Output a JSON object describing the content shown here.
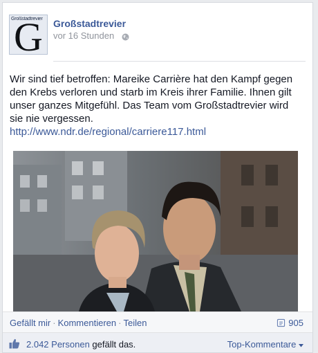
{
  "post": {
    "page_name": "Großstadtrevier",
    "logo_text": "Großstadtrevier",
    "logo_letter": "G",
    "time": "vor 16 Stunden",
    "visibility_icon": "globe-icon",
    "text": "Wir sind tief betroffen: Mareike Carrière hat den Kampf gegen den Krebs verloren und starb im Kreis ihrer Familie. Ihnen gilt unser ganzes Mitgefühl. Das Team vom Großstadtrevier wird sie nie vergessen.",
    "link": "http://www.ndr.de/regional/carriere117.html"
  },
  "actions": {
    "like": "Gefällt mir",
    "separator": "·",
    "comment": "Kommentieren",
    "share": "Teilen",
    "shares_count": "905",
    "shares_icon": "share-icon"
  },
  "likes": {
    "icon": "thumbs-up-icon",
    "count_text": "2.042 Personen",
    "suffix": "gefällt das.",
    "top_comments": "Top-Kommentare",
    "dropdown_icon": "chevron-down-icon"
  },
  "colors": {
    "link": "#3b5998",
    "meta": "#90949c",
    "text": "#141823"
  }
}
